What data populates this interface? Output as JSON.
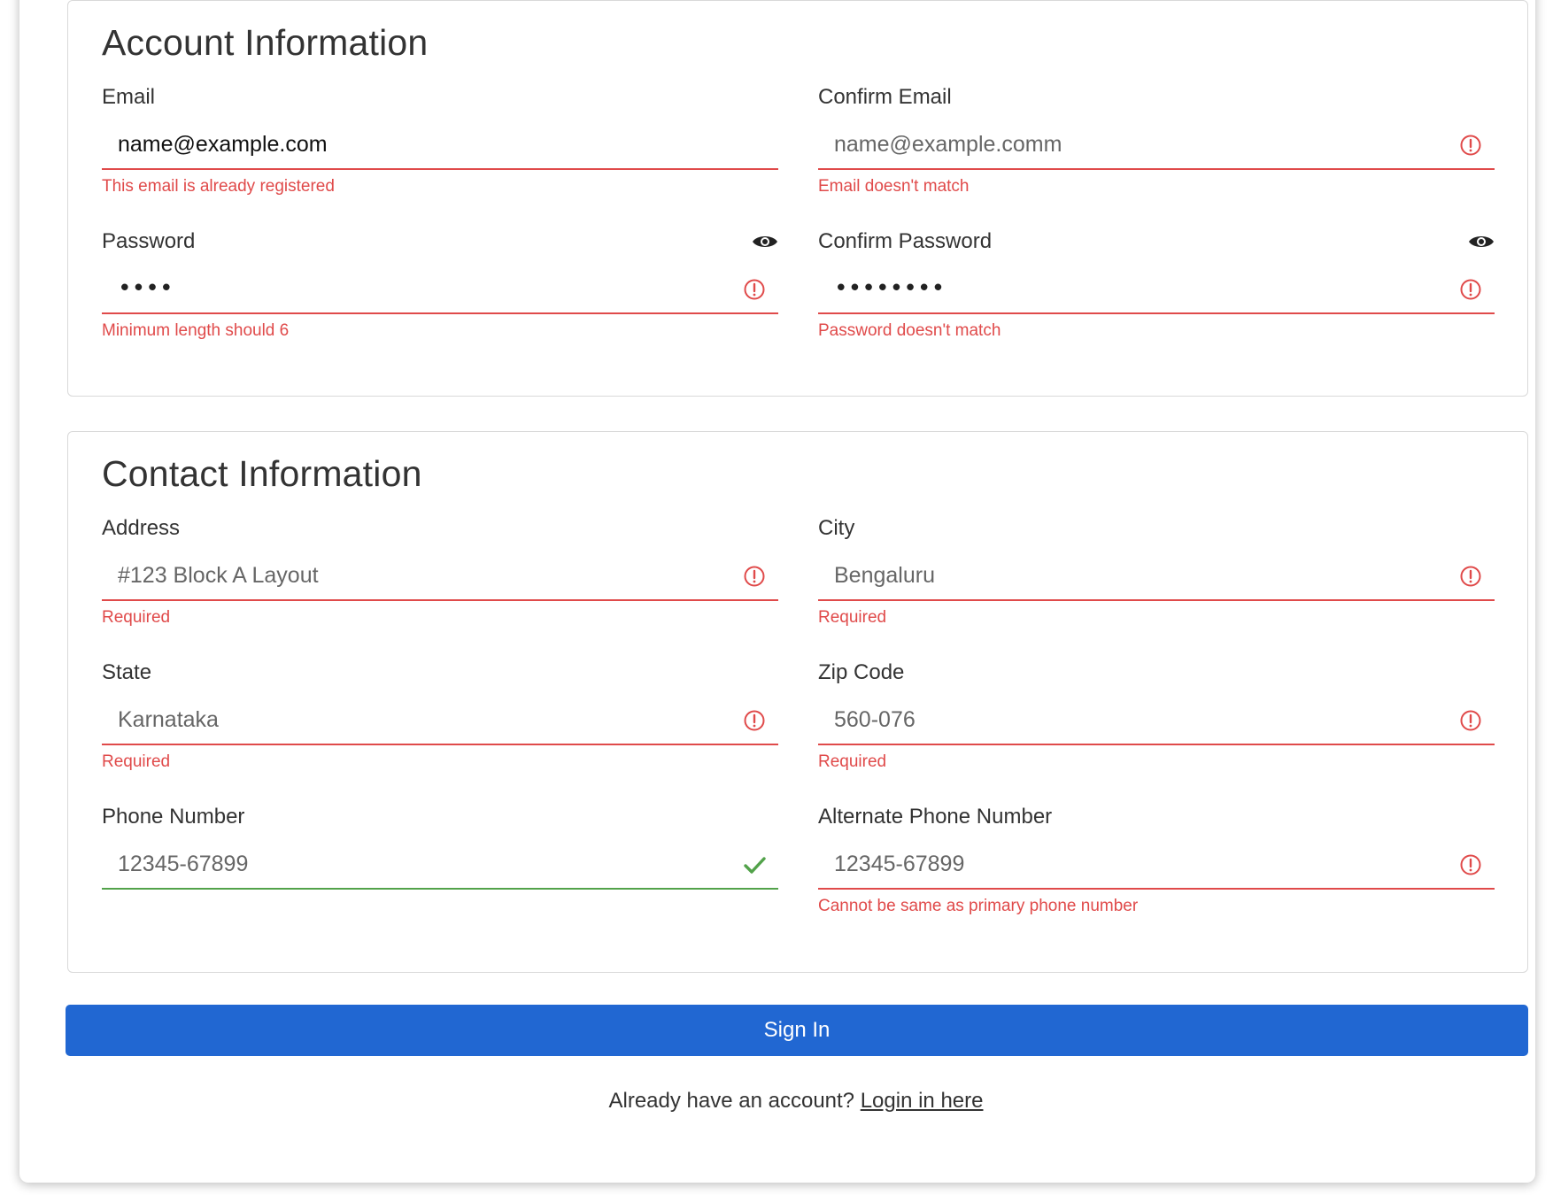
{
  "account": {
    "title": "Account Information",
    "email": {
      "label": "Email",
      "value": "name@example.com",
      "error": "This email is already registered"
    },
    "confirm_email": {
      "label": "Confirm Email",
      "value": "name@example.comm",
      "error": "Email doesn't match"
    },
    "password": {
      "label": "Password",
      "masked": "••••",
      "error": "Minimum length should 6"
    },
    "confirm_password": {
      "label": "Confirm Password",
      "masked": "••••••••",
      "error": "Password doesn't match"
    }
  },
  "contact": {
    "title": "Contact Information",
    "address": {
      "label": "Address",
      "value": "#123 Block A Layout",
      "error": "Required"
    },
    "city": {
      "label": "City",
      "value": "Bengaluru",
      "error": "Required"
    },
    "state": {
      "label": "State",
      "value": "Karnataka",
      "error": "Required"
    },
    "zip": {
      "label": "Zip Code",
      "value": "560-076",
      "error": "Required"
    },
    "phone": {
      "label": "Phone Number",
      "value": "12345-67899"
    },
    "alt_phone": {
      "label": "Alternate Phone Number",
      "value": "12345-67899",
      "error": "Cannot be same as primary phone number"
    }
  },
  "actions": {
    "signin_label": "Sign In",
    "login_prompt": "Already have an account?",
    "login_link": "Login in here"
  },
  "colors": {
    "error": "#e04a4a",
    "valid": "#52a24a",
    "primary": "#2167d2"
  },
  "icons": {
    "error": "error-circle-icon",
    "valid": "checkmark-icon",
    "reveal": "eye-icon"
  }
}
